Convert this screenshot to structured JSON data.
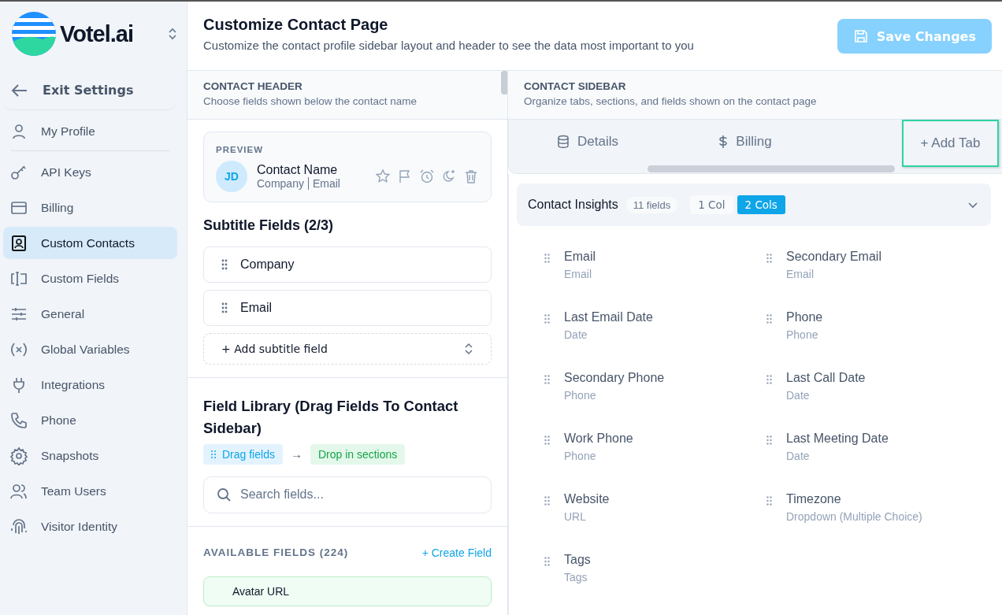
{
  "brand": {
    "name": "Votel.ai"
  },
  "exit": {
    "label": "Exit Settings"
  },
  "nav": [
    {
      "label": "My Profile",
      "selected": false
    },
    {
      "label": "API Keys",
      "selected": false
    },
    {
      "label": "Billing",
      "selected": false
    },
    {
      "label": "Custom Contacts",
      "selected": true
    },
    {
      "label": "Custom Fields",
      "selected": false
    },
    {
      "label": "General",
      "selected": false
    },
    {
      "label": "Global Variables",
      "selected": false
    },
    {
      "label": "Integrations",
      "selected": false
    },
    {
      "label": "Phone",
      "selected": false
    },
    {
      "label": "Snapshots",
      "selected": false
    },
    {
      "label": "Team Users",
      "selected": false
    },
    {
      "label": "Visitor Identity",
      "selected": false
    }
  ],
  "page": {
    "title": "Customize Contact Page",
    "subtitle": "Customize the contact profile sidebar layout and header to see the data most important to you",
    "save": {
      "label": "Save Changes",
      "disabled": true
    }
  },
  "header_panel": {
    "title": "CONTACT HEADER",
    "subtitle": "Choose fields shown below the contact name",
    "preview": {
      "label": "PREVIEW",
      "initials": "JD",
      "name": "Contact Name",
      "company": "Company",
      "email": "Email"
    },
    "subtitle_title": "Subtitle Fields (2/3)",
    "subtitle_fields": [
      "Company",
      "Email"
    ],
    "add_subtitle": "+ Add subtitle field"
  },
  "library": {
    "title": "Field Library (Drag Fields To Contact Sidebar)",
    "drag": "Drag fields",
    "arrow": "→",
    "drop": "Drop in sections",
    "search": {
      "placeholder": "Search fields..."
    },
    "available": "AVAILABLE FIELDS (224)",
    "create": "+ Create Field",
    "fields": [
      "Avatar URL"
    ]
  },
  "sidebar_panel": {
    "title": "CONTACT SIDEBAR",
    "subtitle": "Organize tabs, sections, and fields shown on the contact page",
    "tabs": [
      {
        "label": "Details",
        "selected": false
      },
      {
        "label": "Billing",
        "selected": false
      }
    ],
    "add_tab": "+ Add Tab",
    "section": {
      "title": "Contact Insights",
      "count": "11 fields",
      "layouts": [
        {
          "label": "1 Col",
          "selected": false
        },
        {
          "label": "2 Cols",
          "selected": true
        }
      ],
      "expanded": true,
      "fields": [
        {
          "name": "Email",
          "type": "Email"
        },
        {
          "name": "Secondary Email",
          "type": "Email"
        },
        {
          "name": "Last Email Date",
          "type": "Date"
        },
        {
          "name": "Phone",
          "type": "Phone"
        },
        {
          "name": "Secondary Phone",
          "type": "Phone"
        },
        {
          "name": "Last Call Date",
          "type": "Date"
        },
        {
          "name": "Work Phone",
          "type": "Phone"
        },
        {
          "name": "Last Meeting Date",
          "type": "Date"
        },
        {
          "name": "Website",
          "type": "URL"
        },
        {
          "name": "Timezone",
          "type": "Dropdown (Multiple Choice)"
        },
        {
          "name": "Tags",
          "type": "Tags"
        }
      ]
    }
  }
}
